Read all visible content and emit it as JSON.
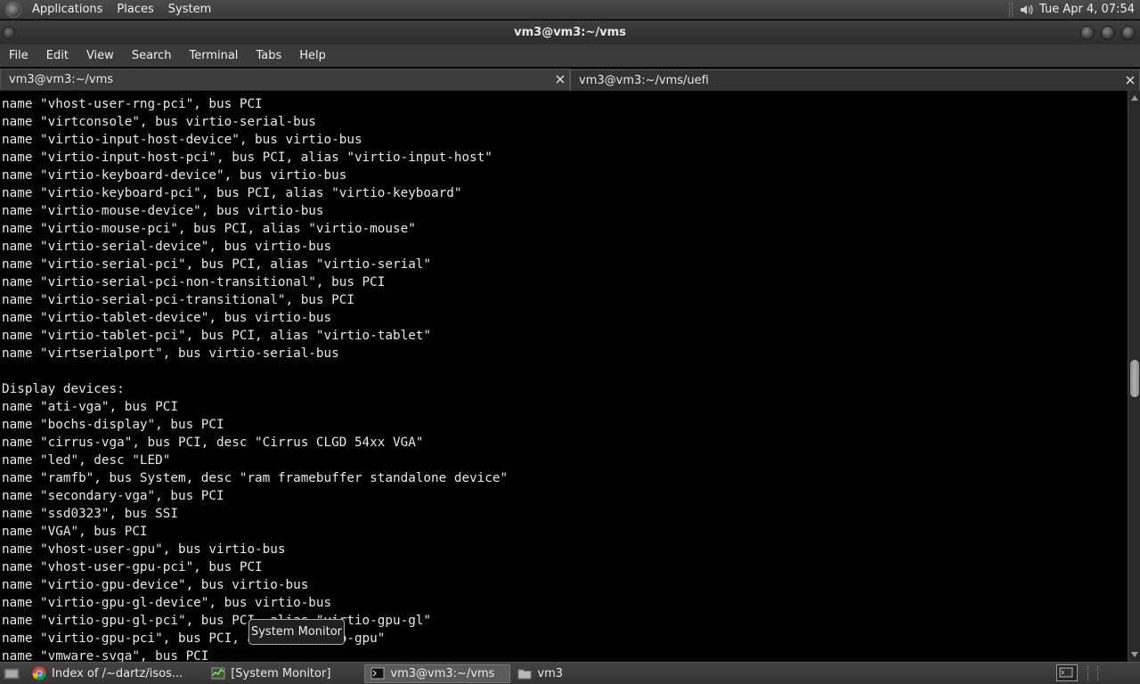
{
  "top_panel": {
    "menus": [
      "Applications",
      "Places",
      "System"
    ],
    "clock": "Tue Apr  4, 07:54"
  },
  "window": {
    "title": "vm3@vm3:~/vms"
  },
  "menubar": {
    "items": [
      "File",
      "Edit",
      "View",
      "Search",
      "Terminal",
      "Tabs",
      "Help"
    ]
  },
  "tabs": [
    {
      "label": "vm3@vm3:~/vms",
      "active": true
    },
    {
      "label": "vm3@vm3:~/vms/uefi",
      "active": false
    }
  ],
  "terminal": {
    "lines": [
      "name \"vhost-user-rng-pci\", bus PCI",
      "name \"virtconsole\", bus virtio-serial-bus",
      "name \"virtio-input-host-device\", bus virtio-bus",
      "name \"virtio-input-host-pci\", bus PCI, alias \"virtio-input-host\"",
      "name \"virtio-keyboard-device\", bus virtio-bus",
      "name \"virtio-keyboard-pci\", bus PCI, alias \"virtio-keyboard\"",
      "name \"virtio-mouse-device\", bus virtio-bus",
      "name \"virtio-mouse-pci\", bus PCI, alias \"virtio-mouse\"",
      "name \"virtio-serial-device\", bus virtio-bus",
      "name \"virtio-serial-pci\", bus PCI, alias \"virtio-serial\"",
      "name \"virtio-serial-pci-non-transitional\", bus PCI",
      "name \"virtio-serial-pci-transitional\", bus PCI",
      "name \"virtio-tablet-device\", bus virtio-bus",
      "name \"virtio-tablet-pci\", bus PCI, alias \"virtio-tablet\"",
      "name \"virtserialport\", bus virtio-serial-bus",
      "",
      "Display devices:",
      "name \"ati-vga\", bus PCI",
      "name \"bochs-display\", bus PCI",
      "name \"cirrus-vga\", bus PCI, desc \"Cirrus CLGD 54xx VGA\"",
      "name \"led\", desc \"LED\"",
      "name \"ramfb\", bus System, desc \"ram framebuffer standalone device\"",
      "name \"secondary-vga\", bus PCI",
      "name \"ssd0323\", bus SSI",
      "name \"VGA\", bus PCI",
      "name \"vhost-user-gpu\", bus virtio-bus",
      "name \"vhost-user-gpu-pci\", bus PCI",
      "name \"virtio-gpu-device\", bus virtio-bus",
      "name \"virtio-gpu-gl-device\", bus virtio-bus",
      "name \"virtio-gpu-gl-pci\", bus PCI, alias \"virtio-gpu-gl\"",
      "name \"virtio-gpu-pci\", bus PCI, alias \"virtio-gpu\"",
      "name \"vmware-svga\", bus PCI"
    ]
  },
  "tooltip": "System Monitor",
  "taskbar": {
    "items": [
      {
        "label": "Index of /~dartz/isos...",
        "icon": "chrome-icon",
        "active": false
      },
      {
        "label": "[System Monitor]",
        "icon": "system-monitor-icon",
        "active": false
      },
      {
        "label": "vm3@vm3:~/vms",
        "icon": "terminal-icon",
        "active": true
      },
      {
        "label": "vm3",
        "icon": "folder-icon",
        "active": false
      }
    ]
  },
  "colors": {
    "terminal_bg": "#000000",
    "terminal_fg": "#e8e8e8",
    "panel_bg": "#3a3a3a"
  }
}
